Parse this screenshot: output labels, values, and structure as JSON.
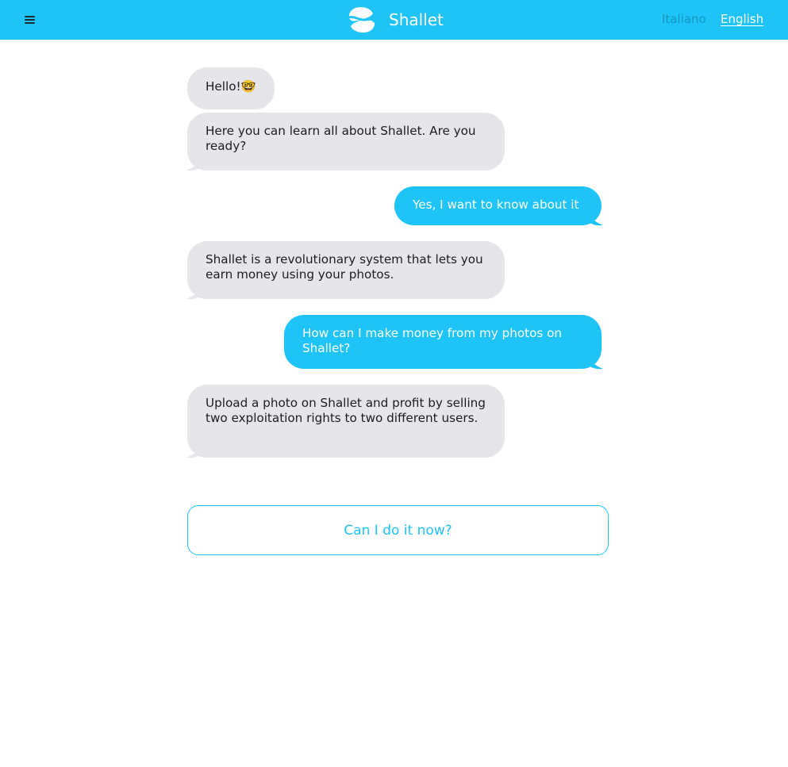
{
  "header": {
    "brand_name": "Shallet",
    "languages": [
      {
        "label": "Italiano",
        "active": false
      },
      {
        "label": "English",
        "active": true
      }
    ],
    "background_color": "#1ec3f7",
    "menu_icon": "hamburger-menu-icon",
    "logo_icon": "shallet-logo-icon"
  },
  "chat": {
    "messages": [
      {
        "sender": "bot",
        "text": "Hello!🤓"
      },
      {
        "sender": "bot",
        "text": "Here you can learn all about Shallet. Are you ready?"
      },
      {
        "sender": "user",
        "text": "Yes, I want to know about it"
      },
      {
        "sender": "bot",
        "text": "Shallet is a revolutionary system that lets you earn money using your photos."
      },
      {
        "sender": "user",
        "text": "How can I make money from my photos on Shallet?"
      },
      {
        "sender": "bot",
        "text": "Upload a photo on Shallet and profit by selling two exploitation rights to two different users."
      }
    ],
    "bot_bubble_color": "#e5e5ea",
    "user_bubble_color": "#1ec3f7"
  },
  "reply_option": {
    "label": "Can I do it now?"
  }
}
